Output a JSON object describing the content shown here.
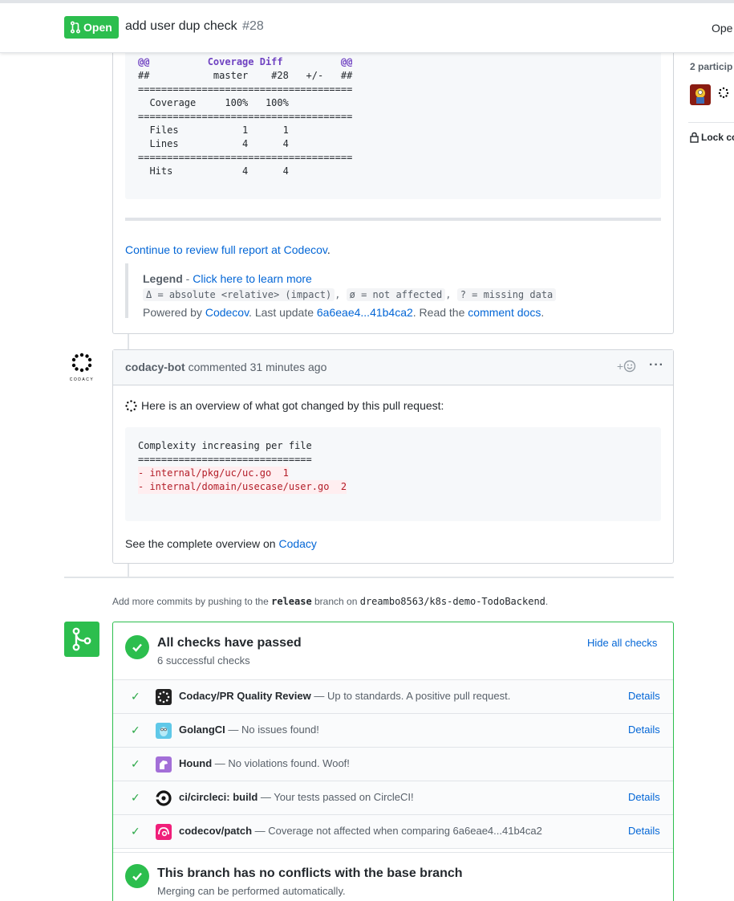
{
  "header": {
    "state": "Open",
    "title": "add user dup check",
    "number": "#28",
    "right_text": "Ope"
  },
  "sidebar": {
    "participants": "2 particip",
    "lock": "Lock co"
  },
  "codecov_comment": {
    "diff_lines": [
      "@@          Coverage Diff          @@",
      "##           master    #28   +/-   ##",
      "=====================================",
      "  Coverage     100%   100%           ",
      "=====================================",
      "  Files           1      1           ",
      "  Lines           4      4           ",
      "=====================================",
      "  Hits            4      4           "
    ],
    "continue_link": "Continue to review full report at Codecov",
    "continue_suffix": ".",
    "legend_label": "Legend",
    "legend_sep": " - ",
    "legend_link": "Click here to learn more",
    "legend_code1": "Δ = absolute <relative> (impact)",
    "legend_code2": "ø = not affected",
    "legend_code3": "? = missing data",
    "powered_prefix": "Powered by ",
    "powered_link": "Codecov",
    "last_update": ". Last update ",
    "commit_range": "6a6eae4...41b4ca2",
    "read_the": ". Read the ",
    "comment_docs": "comment docs",
    "period": "."
  },
  "codacy_comment": {
    "author": "codacy-bot",
    "action": "commented",
    "time": "31 minutes ago",
    "reaction": "+",
    "menu": "···",
    "overview": "Here is an overview of what got changed by this pull request:",
    "code_title": "Complexity increasing per file",
    "code_rule": "==============================",
    "code_lines": [
      "- internal/pkg/uc/uc.go  1",
      "- internal/domain/usecase/user.go  2"
    ],
    "see_prefix": "See the complete overview on ",
    "see_link": "Codacy",
    "avatar_label": "CODACY"
  },
  "push_note": {
    "prefix": "Add more commits by pushing to the ",
    "branch": "release",
    "middle": " branch on ",
    "repo": "dreambo8563/k8s-demo-TodoBackend",
    "suffix": "."
  },
  "checks": {
    "title": "All checks have passed",
    "subtitle": "6 successful checks",
    "hide_label": "Hide all checks",
    "items": [
      {
        "name": "Codacy/PR Quality Review",
        "desc": " — Up to standards. A positive pull request.",
        "details": "Details",
        "icon": "codacy-icon",
        "color": "#222222"
      },
      {
        "name": "GolangCI",
        "desc": " — No issues found!",
        "details": "Details",
        "icon": "golangci-icon",
        "color": "#5fc8e8"
      },
      {
        "name": "Hound",
        "desc": " — No violations found. Woof!",
        "details": "",
        "icon": "hound-icon",
        "color": "#a36fd8"
      },
      {
        "name": "ci/circleci: build",
        "desc": " — Your tests passed on CircleCI!",
        "details": "Details",
        "icon": "circleci-icon",
        "color": "#161616"
      },
      {
        "name": "codecov/patch",
        "desc": " — Coverage not affected when comparing 6a6eae4...41b4ca2",
        "details": "Details",
        "icon": "codecov-icon",
        "color": "#f01f7a"
      }
    ],
    "branch_title": "This branch has no conflicts with the base branch",
    "branch_sub": "Merging can be performed automatically."
  },
  "colors": {
    "green": "#2cbe4e",
    "link": "#0366d6"
  }
}
